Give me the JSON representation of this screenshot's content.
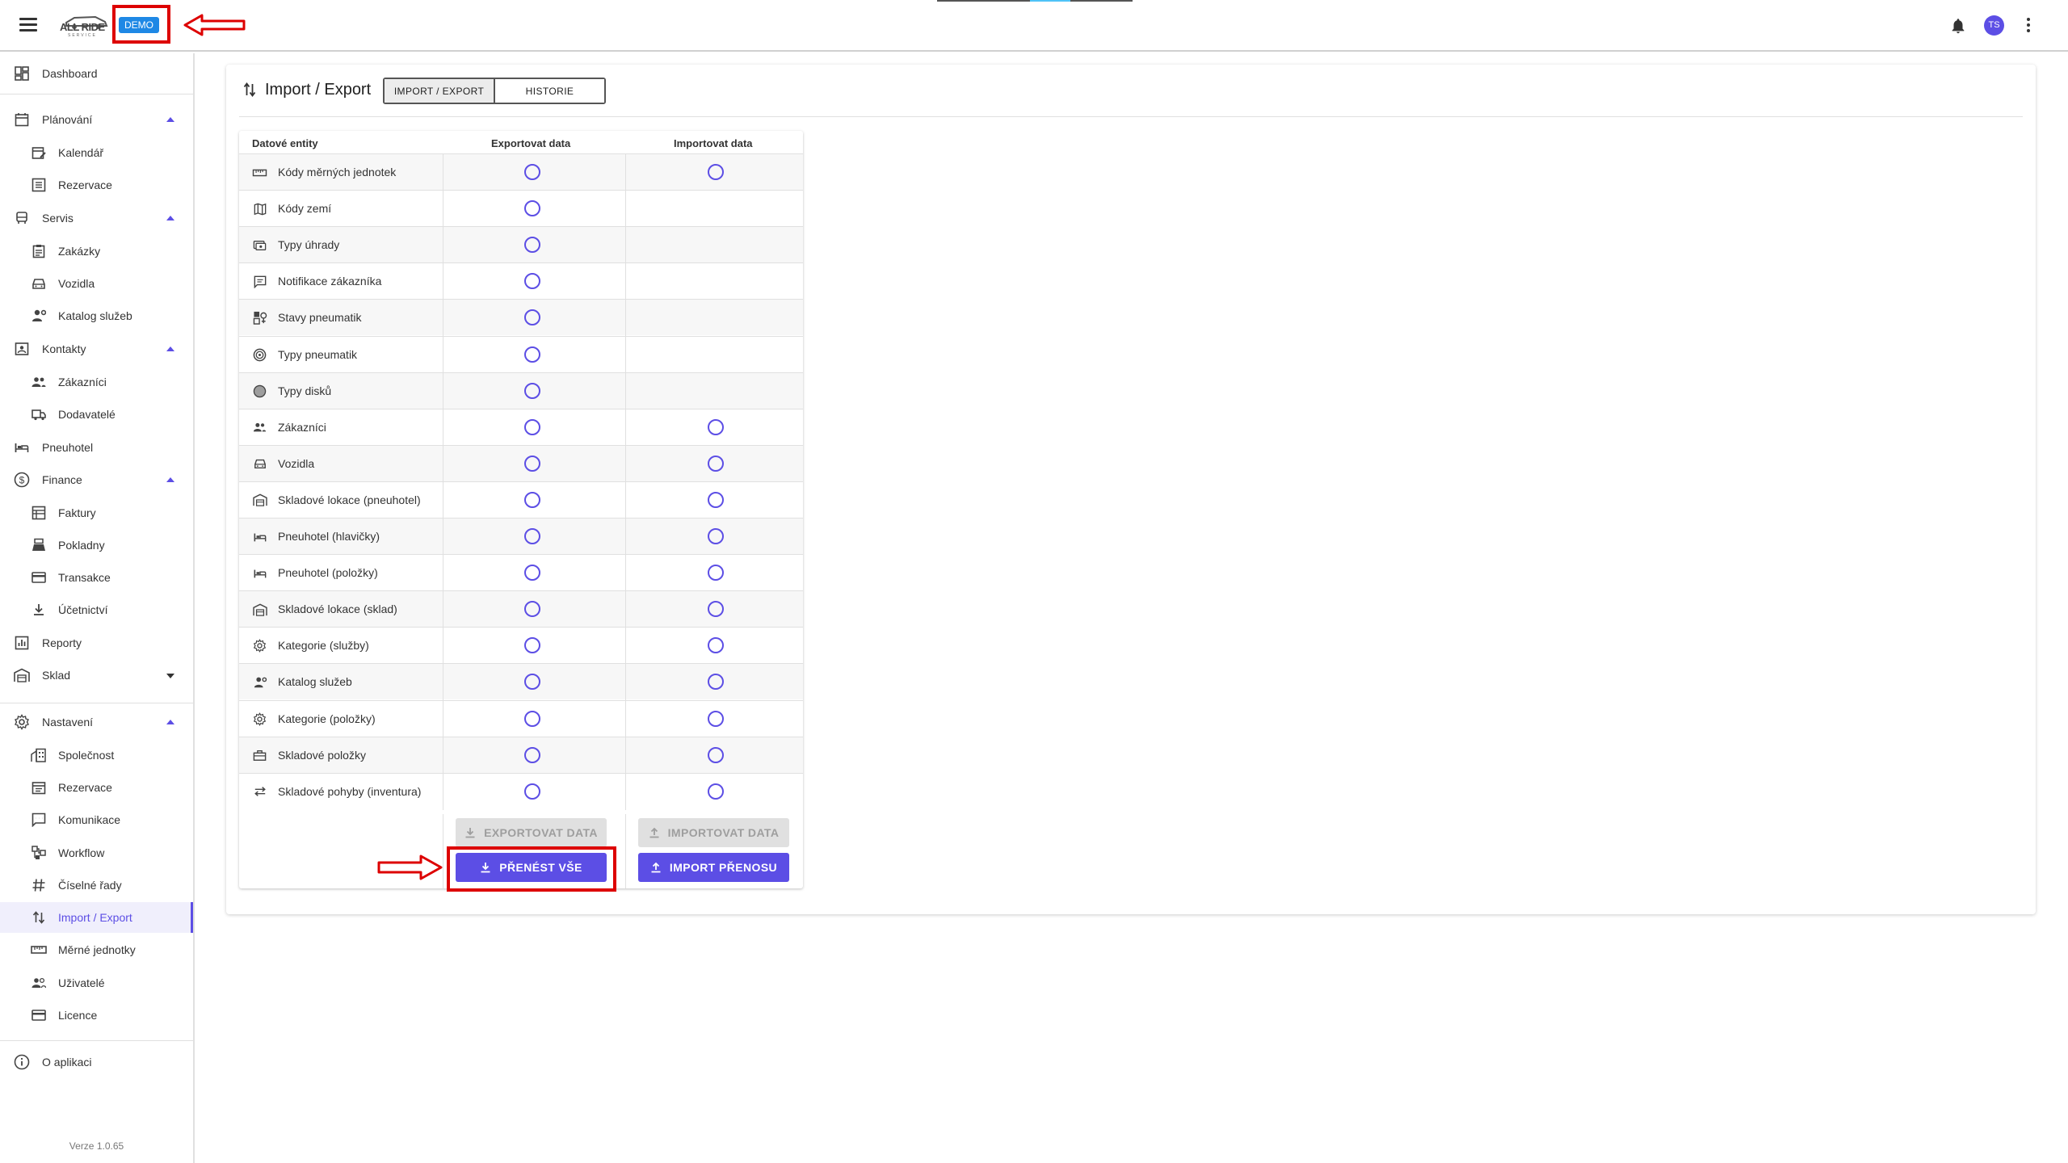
{
  "header": {
    "logo_text": "ALL RIDE",
    "logo_sub": "SERVICE",
    "demo_badge": "DEMO",
    "avatar_initials": "TS"
  },
  "sidebar": {
    "items": [
      {
        "label": "Dashboard",
        "icon": "dashboard-icon"
      },
      {
        "label": "Plánování",
        "icon": "calendar-icon"
      },
      {
        "label": "Kalendář",
        "icon": "calendar-edit-icon"
      },
      {
        "label": "Rezervace",
        "icon": "list-icon"
      },
      {
        "label": "Servis",
        "icon": "car-wash-icon"
      },
      {
        "label": "Zakázky",
        "icon": "clipboard-icon"
      },
      {
        "label": "Vozidla",
        "icon": "car-icon"
      },
      {
        "label": "Katalog služeb",
        "icon": "person-gear-icon"
      },
      {
        "label": "Kontakty",
        "icon": "contacts-icon"
      },
      {
        "label": "Zákazníci",
        "icon": "people-icon"
      },
      {
        "label": "Dodavatelé",
        "icon": "truck-icon"
      },
      {
        "label": "Pneuhotel",
        "icon": "bed-icon"
      },
      {
        "label": "Finance",
        "icon": "dollar-icon"
      },
      {
        "label": "Faktury",
        "icon": "invoice-icon"
      },
      {
        "label": "Pokladny",
        "icon": "cash-register-icon"
      },
      {
        "label": "Transakce",
        "icon": "credit-card-icon"
      },
      {
        "label": "Účetnictví",
        "icon": "download-icon"
      },
      {
        "label": "Reporty",
        "icon": "chart-icon"
      },
      {
        "label": "Sklad",
        "icon": "warehouse-icon"
      },
      {
        "label": "Nastavení",
        "icon": "settings-icon"
      },
      {
        "label": "Společnost",
        "icon": "building-icon"
      },
      {
        "label": "Rezervace",
        "icon": "calendar-list-icon"
      },
      {
        "label": "Komunikace",
        "icon": "message-icon"
      },
      {
        "label": "Workflow",
        "icon": "workflow-icon"
      },
      {
        "label": "Číselné řady",
        "icon": "hash-icon"
      },
      {
        "label": "Import / Export",
        "icon": "swap-vertical-icon"
      },
      {
        "label": "Měrné jednotky",
        "icon": "ruler-icon"
      },
      {
        "label": "Uživatelé",
        "icon": "users-icon"
      },
      {
        "label": "Licence",
        "icon": "license-icon"
      },
      {
        "label": "O aplikaci",
        "icon": "info-icon"
      }
    ],
    "version": "Verze 1.0.65"
  },
  "page": {
    "title": "Import / Export",
    "tabs": [
      "IMPORT / EXPORT",
      "HISTORIE"
    ]
  },
  "table": {
    "headers": [
      "Datové entity",
      "Exportovat data",
      "Importovat data"
    ],
    "rows": [
      {
        "label": "Kódy měrných jednotek",
        "icon": "ruler-icon",
        "export": true,
        "import": true
      },
      {
        "label": "Kódy zemí",
        "icon": "map-icon",
        "export": true,
        "import": false
      },
      {
        "label": "Typy úhrady",
        "icon": "payment-icon",
        "export": true,
        "import": false
      },
      {
        "label": "Notifikace zákazníka",
        "icon": "message-icon",
        "export": true,
        "import": false
      },
      {
        "label": "Stavy pneumatik",
        "icon": "tire-status-icon",
        "export": true,
        "import": false
      },
      {
        "label": "Typy pneumatik",
        "icon": "tire-icon",
        "export": true,
        "import": false
      },
      {
        "label": "Typy disků",
        "icon": "disc-icon",
        "export": true,
        "import": false
      },
      {
        "label": "Zákazníci",
        "icon": "people-icon",
        "export": true,
        "import": true
      },
      {
        "label": "Vozidla",
        "icon": "car-icon",
        "export": true,
        "import": true
      },
      {
        "label": "Skladové lokace (pneuhotel)",
        "icon": "warehouse-icon",
        "export": true,
        "import": true
      },
      {
        "label": "Pneuhotel (hlavičky)",
        "icon": "bed-icon",
        "export": true,
        "import": true
      },
      {
        "label": "Pneuhotel (položky)",
        "icon": "bed-icon",
        "export": true,
        "import": true
      },
      {
        "label": "Skladové lokace (sklad)",
        "icon": "warehouse-icon",
        "export": true,
        "import": true
      },
      {
        "label": "Kategorie (služby)",
        "icon": "settings-icon",
        "export": true,
        "import": true
      },
      {
        "label": "Katalog služeb",
        "icon": "person-gear-icon",
        "export": true,
        "import": true
      },
      {
        "label": "Kategorie (položky)",
        "icon": "settings-icon",
        "export": true,
        "import": true
      },
      {
        "label": "Skladové položky",
        "icon": "toolbox-icon",
        "export": true,
        "import": true
      },
      {
        "label": "Skladové pohyby (inventura)",
        "icon": "swap-horizontal-icon",
        "export": true,
        "import": true
      }
    ]
  },
  "buttons": {
    "export_data": "EXPORTOVAT DATA",
    "import_data": "IMPORTOVAT DATA",
    "transfer_all": "PŘENÉST VŠE",
    "import_transfer": "IMPORT PŘENOSU"
  },
  "colors": {
    "accent": "#5c4ee5",
    "demo_badge": "#1e88e5",
    "annotation": "#dd0000"
  }
}
